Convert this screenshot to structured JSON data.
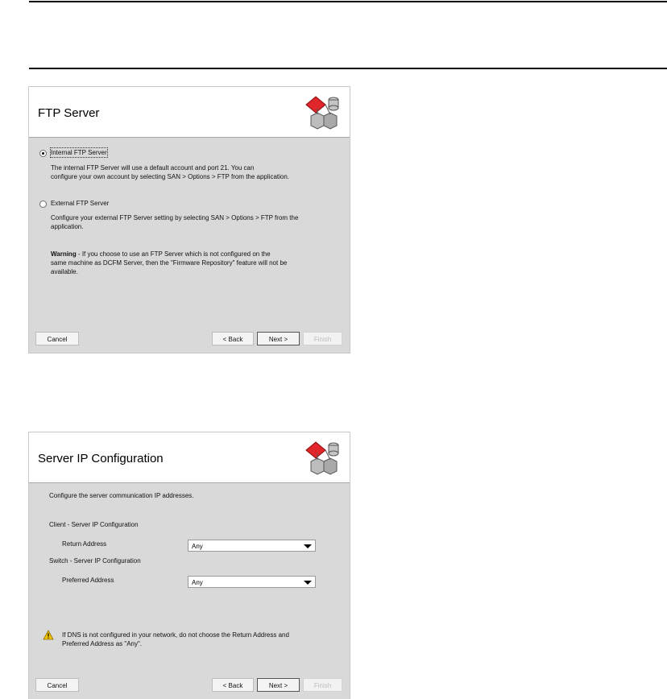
{
  "dialog1": {
    "title": "FTP Server",
    "internal": {
      "label": "Internal FTP Server",
      "desc_line1": "The internal FTP Server will use a default account and port 21. You can",
      "desc_line2": "configure your own account by selecting SAN > Options > FTP from the application."
    },
    "external": {
      "label": "External FTP Server",
      "desc_line1": "Configure your external FTP Server setting by selecting SAN > Options > FTP from the",
      "desc_line2": "application."
    },
    "warning": {
      "bold": "Warning",
      "line1": " - If you choose to use an FTP Server which is not configured on the",
      "line2": "same machine as DCFM Server, then the \"Firmware Repository\" feature will not be",
      "line3": "available."
    },
    "buttons": {
      "cancel": "Cancel",
      "back": "< Back",
      "next": "Next >",
      "finish": "Finish"
    }
  },
  "dialog2": {
    "title": "Server IP Configuration",
    "intro": "Configure the server communication IP addresses.",
    "client_section": "Client - Server IP Configuration",
    "return_address_label": "Return Address",
    "return_address_value": "Any",
    "switch_section": "Switch - Server IP Configuration",
    "preferred_address_label": "Preferred Address",
    "preferred_address_value": "Any",
    "warning_line1": "If DNS is not configured in your network, do not choose the Return Address and",
    "warning_line2": "Preferred Address as \"Any\".",
    "buttons": {
      "cancel": "Cancel",
      "back": "< Back",
      "next": "Next >",
      "finish": "Finish"
    }
  },
  "colors": {
    "dialog_bg": "#d9d9d9",
    "logo_red": "#e0262b",
    "warning_yellow": "#f2c300"
  },
  "icons": {
    "logo": "network-servers-logo-icon",
    "warning": "warning-icon"
  }
}
